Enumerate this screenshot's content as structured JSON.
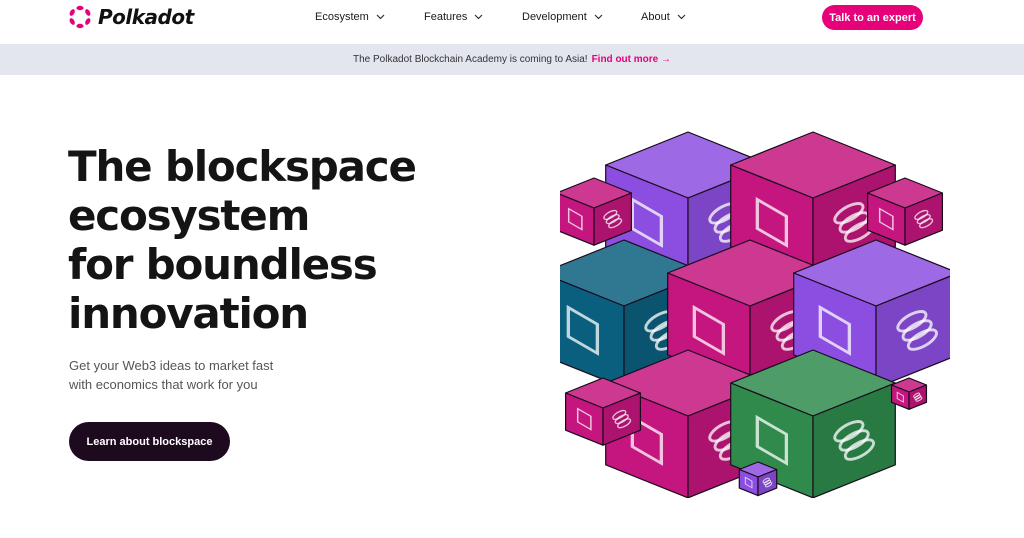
{
  "header": {
    "brand": "Polkadot",
    "nav": [
      {
        "label": "Ecosystem"
      },
      {
        "label": "Features"
      },
      {
        "label": "Development"
      },
      {
        "label": "About"
      }
    ],
    "cta_label": "Talk to an expert"
  },
  "banner": {
    "text": "The Polkadot Blockchain Academy is coming to Asia!",
    "link_label": "Find out more →"
  },
  "hero": {
    "title_lines": [
      "The blockspace",
      "ecosystem",
      "for boundless",
      "innovation"
    ],
    "subtitle_lines": [
      "Get your Web3 ideas to market fast",
      "with economics that work for you"
    ],
    "cta_label": "Learn about blockspace"
  },
  "colors": {
    "brand_pink": "#e6007a",
    "dark": "#1d0a1f",
    "banner_bg": "#e4e6ef",
    "cube_purple": "#8c4ee0",
    "cube_pink": "#c4167e",
    "cube_teal": "#0b5f7e",
    "cube_green": "#2f8a4c"
  }
}
